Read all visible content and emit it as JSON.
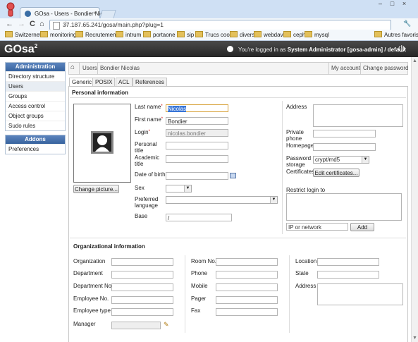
{
  "browser": {
    "tab_title": "GOsa - Users - Bondier Nic",
    "tab_close": "×",
    "url": "37.187.65.241/gosa/main.php?plug=1",
    "window_controls": [
      "–",
      "□",
      "×"
    ],
    "nav": {
      "back": "←",
      "forward": "→",
      "reload": "C",
      "home": "⌂",
      "star": "☆",
      "wrench": "🔧"
    },
    "bookmarks": [
      "Switzernet",
      "monitoring",
      "Recrutement",
      "intrum",
      "portaone",
      "sip",
      "Trucs cool",
      "divers",
      "webdav",
      "ceph",
      "mysql"
    ],
    "other_bookmarks": "Autres favoris"
  },
  "header": {
    "logo": "GOsa",
    "logo_sup": "2",
    "logged_in_prefix": "You're logged in as ",
    "logged_in_user": "System Administrator [gosa-admin] / default"
  },
  "sidebar": {
    "admin_title": "Administration",
    "admin_items": [
      "Directory structure",
      "Users",
      "Groups",
      "Access control",
      "Object groups",
      "Sudo rules"
    ],
    "addons_title": "Addons",
    "addons_items": [
      "Preferences"
    ]
  },
  "breadcrumb": {
    "items": [
      "Users",
      "Bondier Nicolas"
    ],
    "my_account": "My account",
    "change_password": "Change password"
  },
  "tabs": [
    "Generic",
    "POSIX",
    "ACL",
    "References"
  ],
  "personal": {
    "title": "Personal information",
    "change_picture": "Change picture...",
    "last_name_label": "Last name",
    "last_name": "Nicolas",
    "first_name_label": "First name",
    "first_name": "Bondier",
    "login_label": "Login",
    "login": "nicolas.bondier",
    "personal_title_label": [
      "Personal",
      "title"
    ],
    "academic_title_label": [
      "Academic",
      "title"
    ],
    "dob_label": "Date of birth",
    "sex_label": "Sex",
    "pref_lang_label": [
      "Preferred",
      "language"
    ],
    "base_label": "Base",
    "base": "/",
    "address_label": "Address",
    "private_phone_label": [
      "Private",
      "phone"
    ],
    "homepage_label": "Homepage",
    "password_storage_label": [
      "Password",
      "storage"
    ],
    "password_storage": "crypt/md5",
    "certificates_label": "Certificates",
    "edit_certificates": "Edit certificates...",
    "restrict_login_label": "Restrict login to",
    "ip_placeholder": "IP or network",
    "add_button": "Add"
  },
  "org": {
    "title": "Organizational information",
    "col1": [
      "Organization",
      "Department",
      "Department No.",
      "Employee No.",
      "Employee type",
      "Manager"
    ],
    "col2": [
      "Room No.",
      "Phone",
      "Mobile",
      "Pager",
      "Fax"
    ],
    "col3": [
      "Location",
      "State",
      "Address"
    ]
  }
}
